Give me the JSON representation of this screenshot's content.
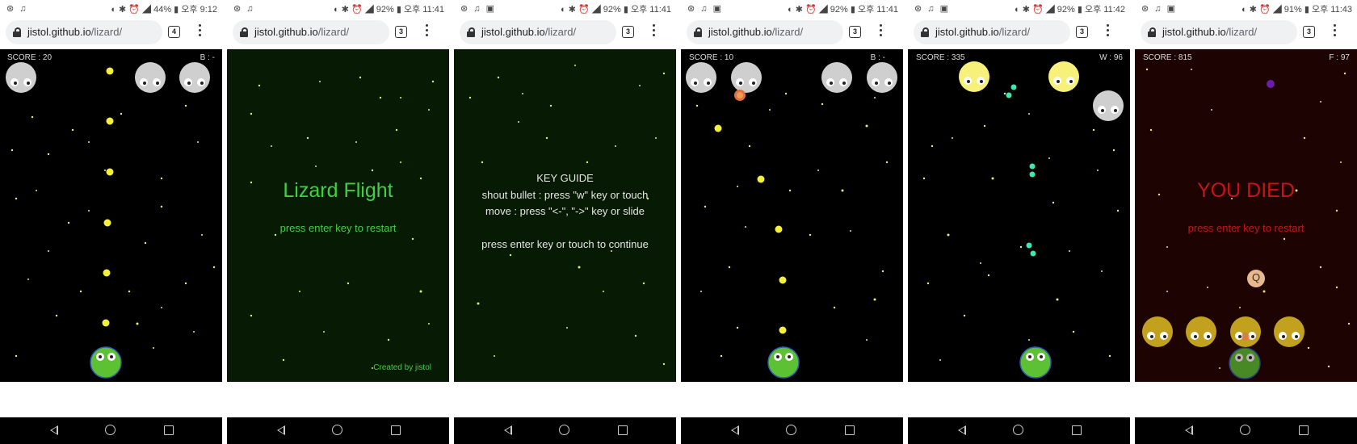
{
  "panels": [
    {
      "status_left": "⊛ ♫",
      "status_right": "◐ ✱ ⏰ ◢ 44% ▮ 오후 9:12",
      "url_host": "jistol.github.io",
      "url_path": "/lizard/",
      "tab_count": "4",
      "hud_left": "SCORE : 20",
      "hud_right": "B : -"
    },
    {
      "status_left": "⊛ ♫",
      "status_right": "◐ ✱ ⏰ ◢ 92% ▮ 오후 11:41",
      "url_host": "jistol.github.io",
      "url_path": "/lizard/",
      "tab_count": "3",
      "title": "Lizard Flight",
      "subtitle": "press enter key to restart",
      "credit": "Created by jistol"
    },
    {
      "status_left": "⊛ ♫ ▣",
      "status_right": "◐ ✱ ⏰ ◢ 92% ▮ 오후 11:41",
      "url_host": "jistol.github.io",
      "url_path": "/lizard/",
      "tab_count": "3",
      "guide": [
        "KEY GUIDE",
        "shout bullet : press \"w\" key or touch",
        "move : press \"<-\", \"->\" key or slide",
        "press enter key or touch to continue"
      ]
    },
    {
      "status_left": "⊛ ♫ ▣",
      "status_right": "◐ ✱ ⏰ ◢ 92% ▮ 오후 11:41",
      "url_host": "jistol.github.io",
      "url_path": "/lizard/",
      "tab_count": "3",
      "hud_left": "SCORE : 10",
      "hud_right": "B : -"
    },
    {
      "status_left": "⊛ ♫ ▣",
      "status_right": "◐ ✱ ⏰ ◢ 92% ▮ 오후 11:42",
      "url_host": "jistol.github.io",
      "url_path": "/lizard/",
      "tab_count": "3",
      "hud_left": "SCORE : 335",
      "hud_right": "W : 96"
    },
    {
      "status_left": "⊛ ♫ ▣",
      "status_right": "◐ ✱ ⏰ ◢ 91% ▮ 오후 11:43",
      "url_host": "jistol.github.io",
      "url_path": "/lizard/",
      "tab_count": "3",
      "hud_left": "SCORE : 815",
      "hud_right": "F : 97",
      "title": "YOU DIED",
      "subtitle": "press enter key to restart",
      "item_label": "Q"
    }
  ],
  "colors": {
    "star": "#e8f07a",
    "bullet": "#f5f03a",
    "green_text": "#3fd23f",
    "red_text": "#c81414",
    "lizard": "#5cc234",
    "enemy_gray": "#cfcfcf",
    "enemy_yellow": "#f7f07a",
    "enemy_gold": "#c2a11e",
    "teal": "#40e8b0"
  },
  "icons": [
    "lock-icon",
    "tab-switcher-icon",
    "more-menu-icon",
    "back-nav-icon",
    "home-nav-icon",
    "recents-nav-icon"
  ]
}
